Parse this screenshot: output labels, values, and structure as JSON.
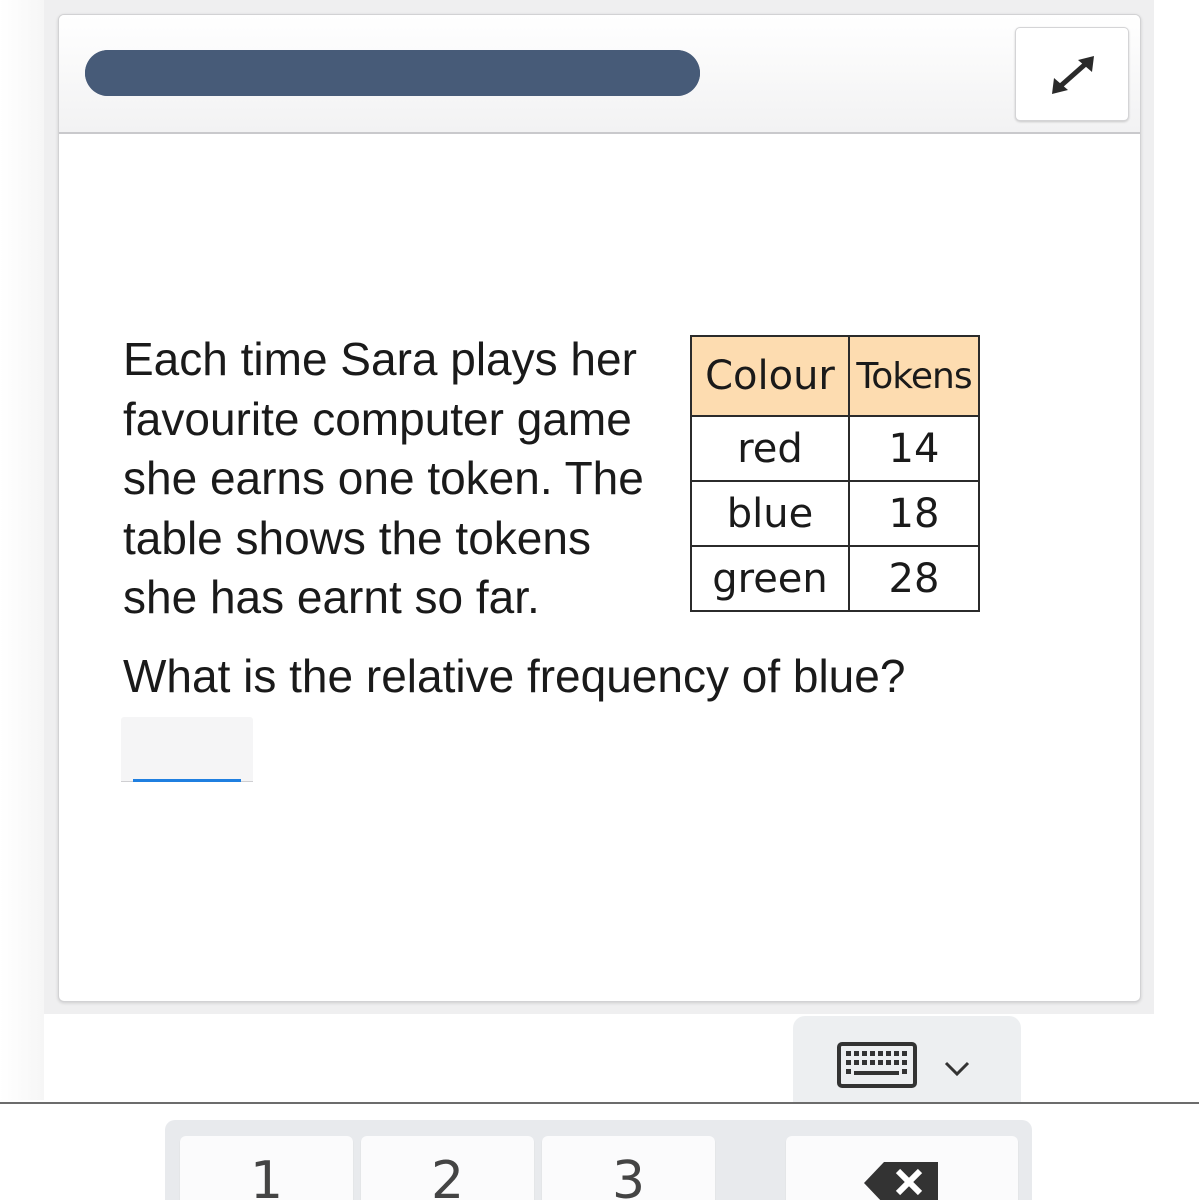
{
  "progress": {
    "value": 1.0
  },
  "question": {
    "intro": "Each time Sara plays her\nfavourite computer game\nshe earns one token. The\ntable shows the tokens\nshe has earnt so far.",
    "prompt": "What is the relative frequency of blue?"
  },
  "table": {
    "headers": [
      "Colour",
      "Tokens"
    ],
    "rows": [
      {
        "colour": "red",
        "tokens": "14"
      },
      {
        "colour": "blue",
        "tokens": "18"
      },
      {
        "colour": "green",
        "tokens": "28"
      }
    ],
    "header_color": "#fddcb0"
  },
  "answer": {
    "value": "",
    "placeholder": ""
  },
  "keypad": {
    "keys": [
      "1",
      "2",
      "3"
    ],
    "backspace_icon": "backspace-icon"
  },
  "icons": {
    "expand": "expand-icon",
    "keyboard": "keyboard-icon",
    "chevron": "chevron-down-icon"
  },
  "colors": {
    "progress": "#475b78",
    "input_accent": "#1f7fe0"
  }
}
